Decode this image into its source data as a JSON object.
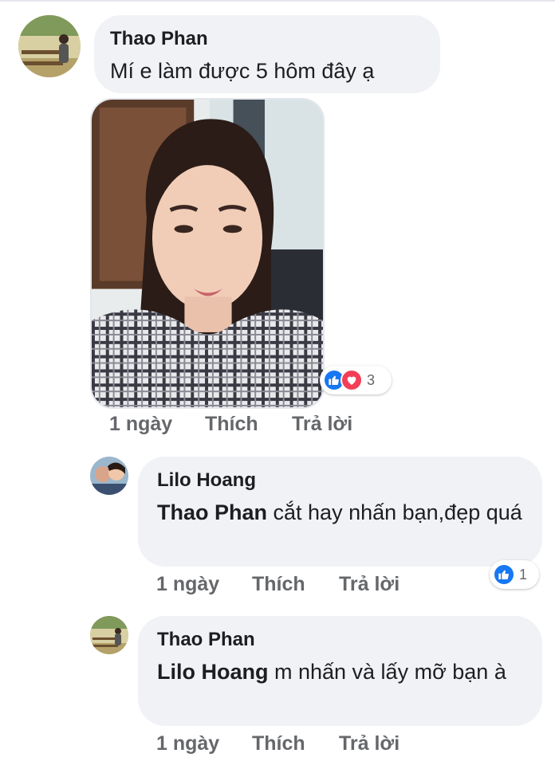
{
  "comments": [
    {
      "author": "Thao Phan",
      "mention": "",
      "text": "Mí e làm được 5 hôm đây ạ",
      "time": "1 ngày",
      "like_label": "Thích",
      "reply_label": "Trả lời",
      "reactions": {
        "icons": [
          "like-icon",
          "love-icon"
        ],
        "count": "3"
      }
    },
    {
      "author": "Lilo Hoang",
      "mention": "Thao Phan",
      "text": " cắt hay nhấn bạn,đẹp quá",
      "time": "1 ngày",
      "like_label": "Thích",
      "reply_label": "Trả lời",
      "reactions": {
        "icons": [
          "like-icon"
        ],
        "count": "1"
      }
    },
    {
      "author": "Thao Phan",
      "mention": "Lilo Hoang",
      "text": " m nhấn và lấy mỡ bạn à",
      "time": "1 ngày",
      "like_label": "Thích",
      "reply_label": "Trả lời"
    }
  ],
  "colors": {
    "bubble": "#f0f2f5",
    "meta_text": "#65676b",
    "like_blue": "#1877f2",
    "love_red": "#f33e58"
  }
}
